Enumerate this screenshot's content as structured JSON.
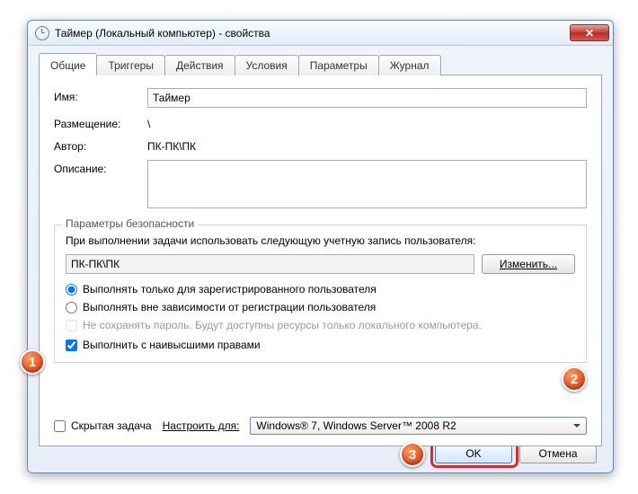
{
  "titlebar": {
    "title": "Таймер (Локальный компьютер) - свойства"
  },
  "tabs": {
    "general": "Общие",
    "triggers": "Триггеры",
    "actions": "Действия",
    "conditions": "Условия",
    "settings": "Параметры",
    "history": "Журнал"
  },
  "fields": {
    "name_label": "Имя:",
    "name_value": "Таймер",
    "location_label": "Размещение:",
    "location_value": "\\",
    "author_label": "Автор:",
    "author_value": "ПК-ПК\\ПК",
    "description_label": "Описание:",
    "description_value": ""
  },
  "security": {
    "group_title": "Параметры безопасности",
    "account_prompt": "При выполнении задачи использовать следующую учетную запись пользователя:",
    "account_value": "ПК-ПК\\ПК",
    "change_btn": "Изменить...",
    "run_logged_on": "Выполнять только для зарегистрированного пользователя",
    "run_not_logged": "Выполнять вне зависимости от регистрации пользователя",
    "no_password": "Не сохранять пароль. Будут доступны ресурсы только локального компьютера.",
    "highest_priv": "Выполнить с наивысшими правами"
  },
  "configure": {
    "hidden_label": "Скрытая задача",
    "configure_label": "Настроить для:",
    "combo_value": "Windows® 7, Windows Server™ 2008 R2"
  },
  "buttons": {
    "ok": "OK",
    "cancel": "Отмена"
  },
  "markers": {
    "m1": "1",
    "m2": "2",
    "m3": "3"
  }
}
